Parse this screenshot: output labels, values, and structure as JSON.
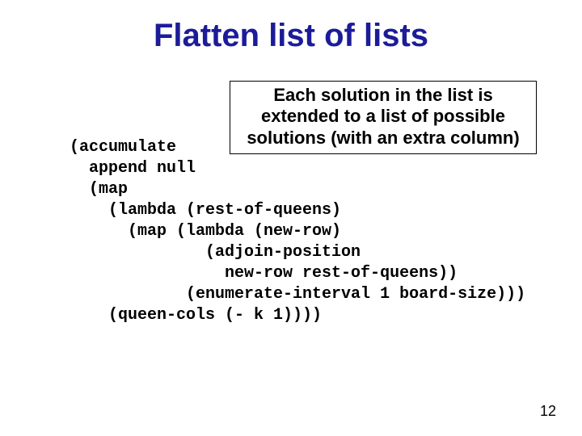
{
  "slide": {
    "title": "Flatten list of lists",
    "callout": "Each solution in the list is extended to a list of possible solutions (with an extra column)",
    "code": "(accumulate\n  append null\n  (map\n    (lambda (rest-of-queens)\n      (map (lambda (new-row)\n              (adjoin-position\n                new-row rest-of-queens))\n            (enumerate-interval 1 board-size)))\n    (queen-cols (- k 1))))",
    "page_number": "12"
  }
}
